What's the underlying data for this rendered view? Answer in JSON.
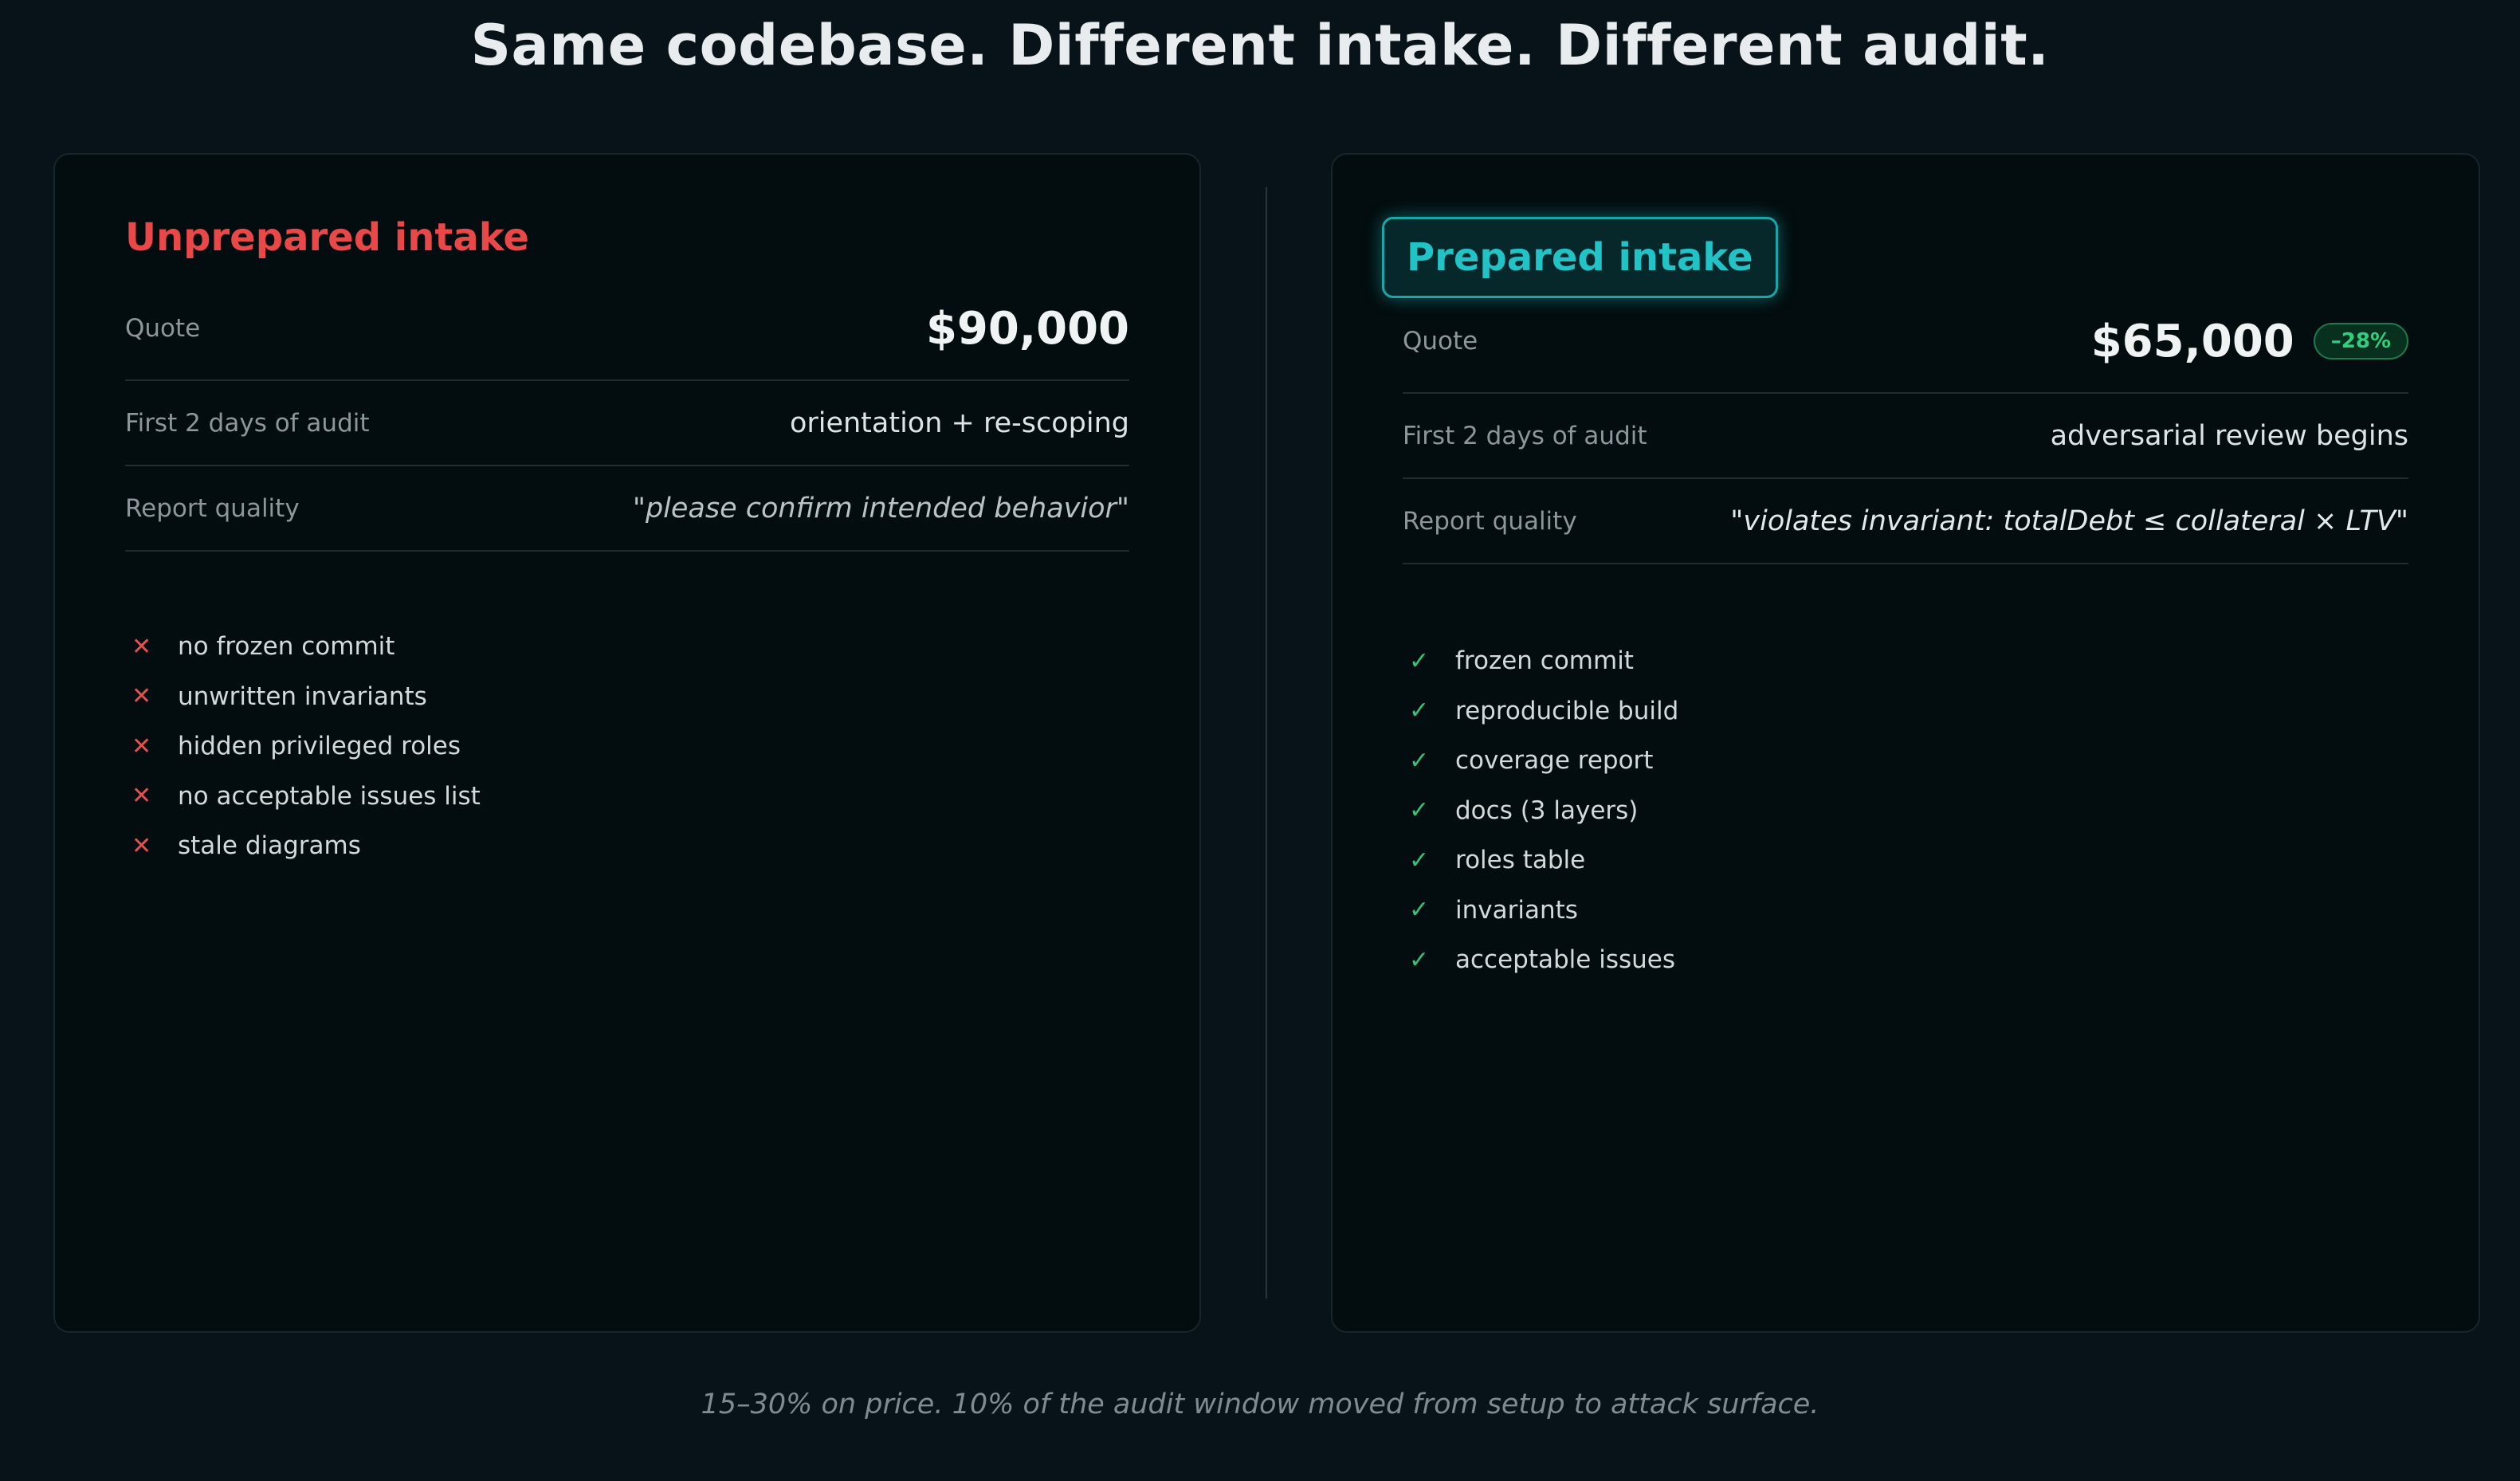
{
  "headline": "Same codebase. Different intake. Different audit.",
  "unprepared": {
    "title": "Unprepared intake",
    "quote_label": "Quote",
    "quote_value": "$90,000",
    "days_label": "First 2 days of audit",
    "days_value": "orientation + re-scoping",
    "report_label": "Report quality",
    "report_value": "\"please confirm intended behavior\"",
    "items": [
      "no frozen commit",
      "unwritten invariants",
      "hidden privileged roles",
      "no acceptable issues list",
      "stale diagrams"
    ],
    "mark_icon": "x-icon",
    "mark_glyph": "✕",
    "accent": "#e94848"
  },
  "prepared": {
    "title": "Prepared intake",
    "quote_label": "Quote",
    "quote_value": "$65,000",
    "quote_badge": "–28%",
    "days_label": "First 2 days of audit",
    "days_value": "adversarial review begins",
    "report_label": "Report quality",
    "report_value": "\"violates invariant: totalDebt ≤ collateral × LTV\"",
    "items": [
      "frozen commit",
      "reproducible build",
      "coverage report",
      "docs (3 layers)",
      "roles table",
      "invariants",
      "acceptable issues"
    ],
    "mark_icon": "check-icon",
    "mark_glyph": "✓",
    "accent": "#22c3c6",
    "badge_color": "#2fd07e"
  },
  "footer": "15–30% on price. 10% of the audit window moved from setup to attack surface."
}
